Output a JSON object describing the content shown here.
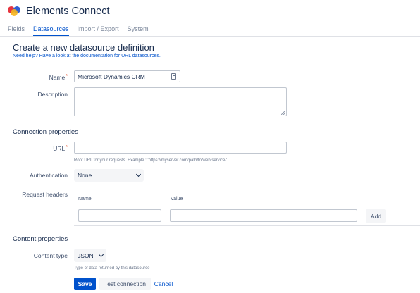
{
  "app": {
    "title": "Elements Connect"
  },
  "tabs": [
    {
      "label": "Fields"
    },
    {
      "label": "Datasources"
    },
    {
      "label": "Import / Export"
    },
    {
      "label": "System"
    }
  ],
  "page": {
    "title": "Create a new datasource definition",
    "help_text": "Need help? Have a look at the documentation for URL datasources."
  },
  "form": {
    "name_label": "Name",
    "required_mark": "*",
    "name_value": "Microsoft Dynamics CRM",
    "description_label": "Description",
    "description_value": "",
    "connection_title": "Connection properties",
    "url_label": "URL",
    "url_value": "",
    "url_hint": "Root URL for your requests. Example : 'https://myserver.com/path/to/web/service/'",
    "auth_label": "Authentication",
    "auth_value": "None",
    "headers_label": "Request headers",
    "headers_col_name": "Name",
    "headers_col_value": "Value",
    "header_name_value": "",
    "header_value_value": "",
    "add_label": "Add",
    "content_title": "Content properties",
    "content_type_label": "Content type",
    "content_type_value": "JSON",
    "content_type_hint": "Type of data returned by this datasource"
  },
  "actions": {
    "save_label": "Save",
    "test_label": "Test connection",
    "cancel_label": "Cancel"
  },
  "colors": {
    "primary": "#0052cc",
    "required": "#de350b",
    "logo_red": "#e6353f",
    "logo_yellow": "#f6b51e",
    "logo_blue": "#2f5fd6"
  }
}
